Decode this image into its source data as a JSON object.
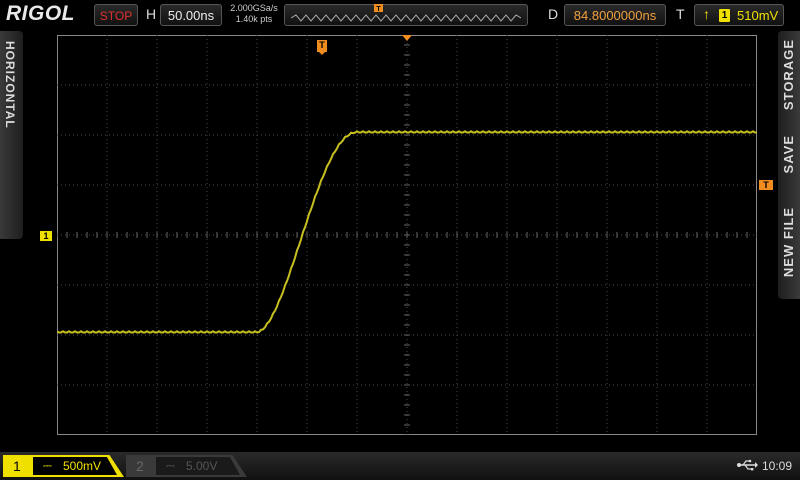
{
  "brand": "RIGOL",
  "status": "STOP",
  "horizontal": {
    "letter": "H",
    "timebase": "50.00ns",
    "sample_rate": "2.000GSa/s",
    "memory_depth": "1.40k pts"
  },
  "delay": {
    "letter": "D",
    "value": "84.8000000ns"
  },
  "trigger": {
    "letter": "T",
    "edge_symbol": "↑",
    "source": "1",
    "level": "510mV",
    "marker": "T"
  },
  "left_tab": "HORIZONTAL",
  "right_tabs": [
    "STORAGE",
    "SAVE",
    "NEW FILE"
  ],
  "channel1": {
    "number": "1",
    "coupling": "⎓",
    "scale": "500mV",
    "marker": "1"
  },
  "channel2": {
    "number": "2",
    "coupling": "⎓",
    "scale": "5.00V"
  },
  "clock": "10:09",
  "colors": {
    "ch1": "#f0e000",
    "trigger": "#f08c20",
    "grid": "#4a4a4a",
    "stop": "#e03030"
  },
  "icons": [
    "usb-icon",
    "rising-edge-icon"
  ],
  "waveform": {
    "description_free": true,
    "time_div": 50,
    "volt_div": 0.5,
    "low_level_div": -1.95,
    "high_level_div": 2.05,
    "rise_start_div": 4.0,
    "rise_end_div": 6.0
  }
}
